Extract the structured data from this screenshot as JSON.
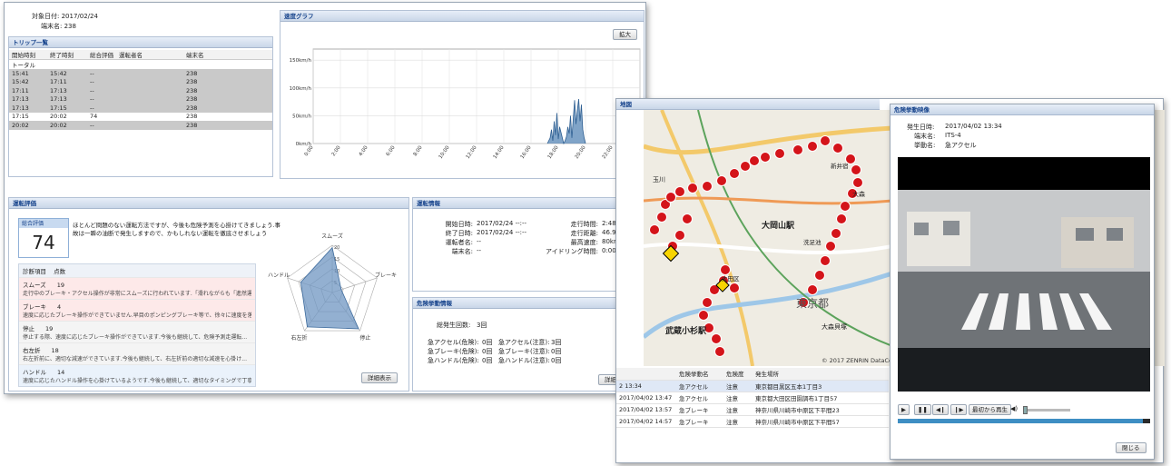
{
  "main_window": {
    "target_date_label": "対象日付:",
    "target_date": "2017/02/24",
    "terminal_label": "端末名:",
    "terminal": "238",
    "trip_list": {
      "title": "トリップ一覧",
      "columns": [
        "開始時刻",
        "終了時刻",
        "総合評価",
        "運転者名",
        "端末名"
      ],
      "total_label": "トータル",
      "rows": [
        {
          "start": "15:41",
          "end": "15:42",
          "score": "--",
          "driver": "",
          "terminal": "238",
          "sel": true
        },
        {
          "start": "15:42",
          "end": "17:11",
          "score": "--",
          "driver": "",
          "terminal": "238",
          "sel": true
        },
        {
          "start": "17:11",
          "end": "17:13",
          "score": "--",
          "driver": "",
          "terminal": "238",
          "sel": true
        },
        {
          "start": "17:13",
          "end": "17:13",
          "score": "--",
          "driver": "",
          "terminal": "238",
          "sel": true
        },
        {
          "start": "17:13",
          "end": "17:15",
          "score": "--",
          "driver": "",
          "terminal": "238",
          "sel": true
        },
        {
          "start": "17:15",
          "end": "20:02",
          "score": "74",
          "driver": "",
          "terminal": "238",
          "sel": false
        },
        {
          "start": "20:02",
          "end": "20:02",
          "score": "--",
          "driver": "",
          "terminal": "238",
          "sel": true
        }
      ]
    },
    "speed_graph": {
      "title": "速度グラフ",
      "zoom_button": "拡大"
    },
    "driving_eval": {
      "title": "運転評価",
      "total_label": "総合評価",
      "total_score": "74",
      "comment_line1": "ほとんど問題のない運転方法ですが、今後も危険予測を心掛けてきましょう.事",
      "comment_line2": "故は一瞬の油断で発生しますので、かもしれない運転を徹底させましょう",
      "diag_header_item": "診断項目",
      "diag_header_score": "点数",
      "items": [
        {
          "name": "スムーズ",
          "score": "19",
          "desc": "走行中のブレーキ・アクセル操作が非常にスムーズに行われています.「滑れながらも「進然運転...",
          "cls": "pink"
        },
        {
          "name": "ブレーキ",
          "score": "4",
          "desc": "速度に応じたブレーキ操作ができていません.早目のポンピングブレーキ等で、徐々に速度を落と...",
          "cls": "pink"
        },
        {
          "name": "停止",
          "score": "19",
          "desc": "停止する際、速度に応じたブレーキ操作ができています.今後も継続して、危険予測走運転...",
          "cls": "gray"
        },
        {
          "name": "右左折",
          "score": "18",
          "desc": "右左折前に、適切な減速ができています.今後も継続して、右左折前の適切な減速を心掛け...",
          "cls": "gray"
        },
        {
          "name": "ハンドル",
          "score": "14",
          "desc": "速度に応じたハンドル操作を心掛けているようです.今後も継続して、適切なタイミングで丁寧に...",
          "cls": "blue"
        }
      ],
      "radar_labels": [
        "スムーズ",
        "ブレーキ",
        "停止",
        "右左折",
        "ハンドル"
      ],
      "radar_ticks": [
        "20",
        "15",
        "10",
        "5"
      ],
      "detail_button": "詳細表示"
    },
    "driving_info": {
      "title": "運転情報",
      "start_label": "開始日時:",
      "start": "2017/02/24 --:--",
      "end_label": "終了日時:",
      "end": "2017/02/24 --:--",
      "driver_label": "運転者名:",
      "driver": "--",
      "terminal_label": "端末名:",
      "terminal": "--",
      "run_time_label": "走行時間:",
      "run_time": "2:48:07",
      "distance_label": "走行距離:",
      "distance": "46.9km",
      "max_speed_label": "最高速度:",
      "max_speed": "80km/h",
      "idle_label": "アイドリング時間:",
      "idle": "0:00:00"
    },
    "danger_info": {
      "title": "危険挙動情報",
      "total_label": "総発生回数:",
      "total": "3回",
      "rows": [
        {
          "a_label": "急アクセル(危険):",
          "a_val": "0回",
          "b_label": "急アクセル(注意):",
          "b_val": "3回"
        },
        {
          "a_label": "急ブレーキ(危険):",
          "a_val": "0回",
          "b_label": "急ブレーキ(注意):",
          "b_val": "0回"
        },
        {
          "a_label": "急ハンドル(危険):",
          "a_val": "0回",
          "b_label": "急ハンドル(注意):",
          "b_val": "0回"
        }
      ],
      "detail_button": "詳細表示"
    }
  },
  "map_window": {
    "title": "地図",
    "place_labels": [
      "大岡山駅",
      "東京都",
      "武蔵小杉駅",
      "玉川",
      "大森",
      "大森貝塚",
      "新井宿",
      "洗足池",
      "大田区"
    ],
    "copyright": "© 2017 ZENRIN DataCom",
    "event_columns": [
      "",
      "危険挙動名",
      "危険度",
      "発生場所"
    ],
    "events": [
      {
        "time": "2 13:34",
        "name": "急アクセル",
        "level": "注意",
        "place": "東京都目黒区五本1丁目3",
        "sel": true
      },
      {
        "time": "2017/04/02 13:47",
        "name": "急アクセル",
        "level": "注意",
        "place": "東京都大田区田園調布1丁目57",
        "sel": false
      },
      {
        "time": "2017/04/02 13:57",
        "name": "急ブレーキ",
        "level": "注意",
        "place": "神奈川県川崎市中原区下平間23",
        "sel": false
      },
      {
        "time": "2017/04/02 14:57",
        "name": "急ブレーキ",
        "level": "注意",
        "place": "神奈川県川崎市中原区下平間57",
        "sel": false
      }
    ]
  },
  "video_window": {
    "title": "危険挙動映像",
    "occur_label": "発生日時:",
    "occur": "2017/04/02 13:34",
    "terminal_label": "端末名:",
    "terminal": "ITS-4",
    "behavior_label": "挙動名:",
    "behavior": "急アクセル",
    "replay_label": "最初から再生",
    "close_button": "閉じる",
    "progress": 0.97
  },
  "chart_data": {
    "type": "line",
    "title": "",
    "xlabel": "",
    "ylabel": "",
    "x_ticks": [
      "0:00",
      "2:00",
      "4:00",
      "6:00",
      "8:00",
      "10:00",
      "12:00",
      "14:00",
      "16:00",
      "18:00",
      "20:00",
      "22:00",
      "0:00"
    ],
    "y_ticks": [
      "0km/h",
      "50km/h",
      "100km/h",
      "150km/h"
    ],
    "ylim": [
      0,
      170
    ],
    "xlim": [
      0,
      24
    ],
    "series": [
      {
        "x": [
          17.2,
          17.4,
          17.5,
          17.6,
          17.7,
          17.8,
          17.9,
          18.0,
          18.1,
          18.2,
          18.3,
          18.4,
          18.5,
          18.6,
          18.7,
          18.8,
          18.9,
          19.0,
          19.1,
          19.2,
          19.3,
          19.4,
          19.5,
          19.6,
          19.7,
          19.8,
          19.9,
          20.0
        ],
        "y": [
          0,
          10,
          25,
          5,
          40,
          15,
          55,
          8,
          30,
          20,
          10,
          0,
          5,
          12,
          30,
          18,
          50,
          10,
          45,
          78,
          35,
          60,
          80,
          40,
          70,
          25,
          10,
          0
        ]
      }
    ]
  }
}
